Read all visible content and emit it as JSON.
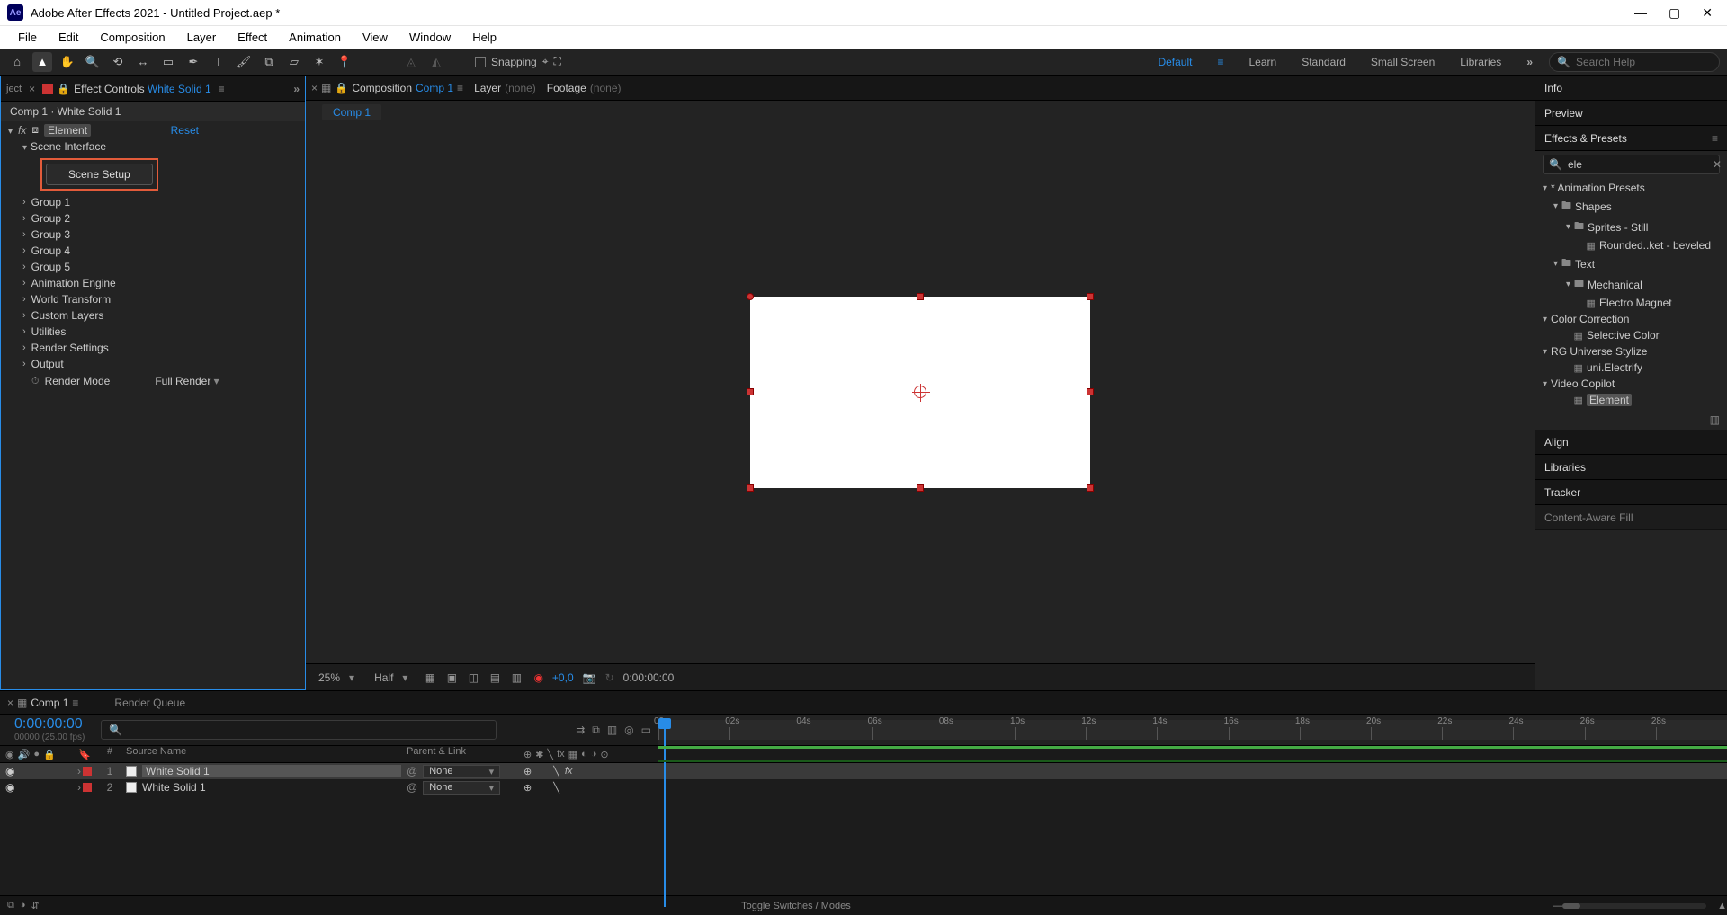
{
  "titlebar": {
    "app_icon": "Ae",
    "title": "Adobe After Effects 2021 - Untitled Project.aep *"
  },
  "menu": [
    "File",
    "Edit",
    "Composition",
    "Layer",
    "Effect",
    "Animation",
    "View",
    "Window",
    "Help"
  ],
  "toolbar": {
    "snapping_label": "Snapping",
    "workspaces": [
      "Default",
      "Learn",
      "Standard",
      "Small Screen",
      "Libraries"
    ],
    "active_workspace": "Default",
    "search_placeholder": "Search Help"
  },
  "effect_controls": {
    "prev_tab": "ject",
    "tab_prefix": "Effect Controls",
    "tab_subject": "White Solid 1",
    "crumb": "Comp 1 · White Solid 1",
    "fx_name": "Element",
    "reset": "Reset",
    "scene_interface": "Scene Interface",
    "scene_setup": "Scene Setup",
    "groups": [
      "Group 1",
      "Group 2",
      "Group 3",
      "Group 4",
      "Group 5",
      "Animation Engine",
      "World Transform",
      "Custom Layers",
      "Utilities",
      "Render Settings",
      "Output"
    ],
    "render_mode_label": "Render Mode",
    "render_mode_value": "Full Render"
  },
  "viewer": {
    "tab_prefix": "Composition",
    "tab_subject": "Comp 1",
    "layer_label": "Layer",
    "footage_label": "Footage",
    "none": "(none)",
    "comp_tab": "Comp 1",
    "footer": {
      "mag": "25%",
      "res": "Half",
      "expo": "+0,0",
      "timecode": "0:00:00:00"
    }
  },
  "right": {
    "panels_top": [
      "Info",
      "Preview"
    ],
    "effects_presets": "Effects & Presets",
    "search_value": "ele",
    "tree": {
      "anim_presets": "* Animation Presets",
      "shapes": "Shapes",
      "sprites": "Sprites - Still",
      "sprites_item": "Rounded..ket - beveled",
      "text": "Text",
      "mechanical": "Mechanical",
      "mech_item": "Electro Magnet",
      "color_corr": "Color Correction",
      "cc_item": "Selective Color",
      "rg": "RG Universe Stylize",
      "rg_item": "uni.Electrify",
      "vc": "Video Copilot",
      "vc_item": "Element"
    },
    "panels_bottom": [
      "Align",
      "Libraries",
      "Tracker",
      "Content-Aware Fill"
    ]
  },
  "timeline": {
    "tab": "Comp 1",
    "render_queue": "Render Queue",
    "timecode": "0:00:00:00",
    "fps": "00000 (25.00 fps)",
    "col_num": "#",
    "col_source": "Source Name",
    "col_parent": "Parent & Link",
    "ruler": [
      "00s",
      "02s",
      "04s",
      "06s",
      "08s",
      "10s",
      "12s",
      "14s",
      "16s",
      "18s",
      "20s",
      "22s",
      "24s",
      "26s",
      "28s"
    ],
    "rows": [
      {
        "num": "1",
        "name": "White Solid 1",
        "parent": "None",
        "fx": true
      },
      {
        "num": "2",
        "name": "White Solid 1",
        "parent": "None",
        "fx": false
      }
    ],
    "toggle_label": "Toggle Switches / Modes"
  }
}
